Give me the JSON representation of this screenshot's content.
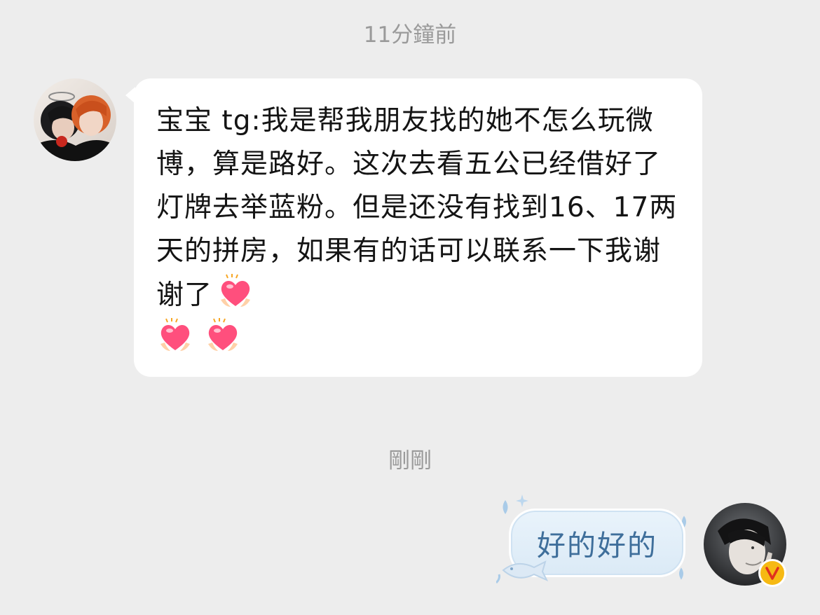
{
  "conversation": {
    "timestamps": {
      "first": "11分鐘前",
      "second": "剛剛"
    },
    "incoming": {
      "avatar_icon": "user-avatar-icon",
      "text": "宝宝 tg:我是帮我朋友找的她不怎么玩微博，算是路好。这次去看五公已经借好了灯牌去举蓝粉。但是还没有找到16、17两天的拼房，如果有的话可以联系一下我谢谢了",
      "emojis": [
        "heart-hands-emoji",
        "heart-hands-emoji",
        "heart-hands-emoji"
      ]
    },
    "outgoing": {
      "avatar_icon": "self-avatar-icon",
      "text": "好的好的",
      "badge_icon": "verified-v-badge-icon"
    }
  },
  "colors": {
    "background": "#ededed",
    "bubble_incoming": "#ffffff",
    "bubble_outgoing": "#dbeaf6",
    "outgoing_text": "#3f6f9b",
    "badge": "#f6b913",
    "timestamp": "#9a9a9a"
  }
}
